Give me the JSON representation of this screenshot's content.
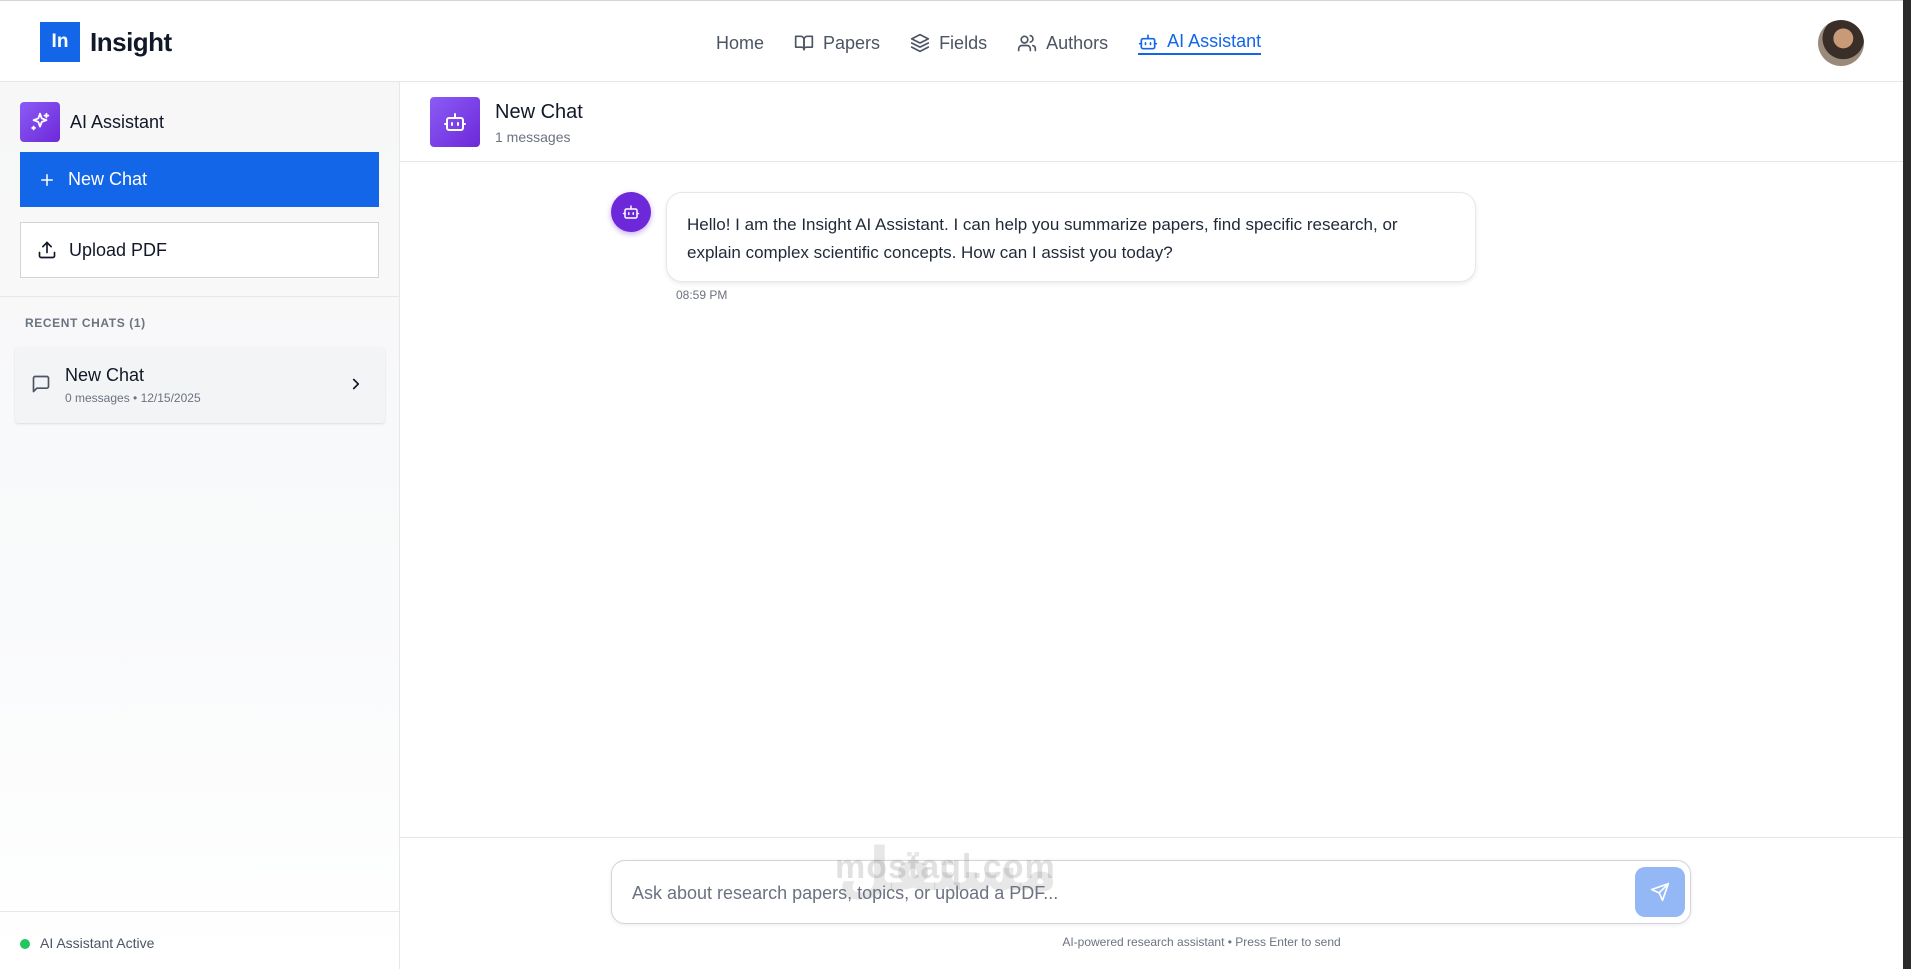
{
  "brand": {
    "mark": "In",
    "name": "Insight"
  },
  "nav": {
    "items": [
      {
        "label": "Home",
        "icon": "none"
      },
      {
        "label": "Papers",
        "icon": "book-icon"
      },
      {
        "label": "Fields",
        "icon": "layers-icon"
      },
      {
        "label": "Authors",
        "icon": "users-icon"
      },
      {
        "label": "AI Assistant",
        "icon": "bot-icon",
        "active": true
      }
    ]
  },
  "sidebar": {
    "title": "AI Assistant",
    "new_chat_label": "New Chat",
    "upload_label": "Upload PDF",
    "recent_label": "RECENT CHATS (1)",
    "recent_chats": [
      {
        "title": "New Chat",
        "meta": "0 messages • 12/15/2025"
      }
    ],
    "status": "AI Assistant Active"
  },
  "chat": {
    "title": "New Chat",
    "subtitle": "1 messages",
    "messages": [
      {
        "role": "assistant",
        "text": "Hello! I am the Insight AI Assistant. I can help you summarize papers, find specific research, or explain complex scientific concepts. How can I assist you today?",
        "time": "08:59 PM"
      }
    ],
    "input_placeholder": "Ask about research papers, topics, or upload a PDF...",
    "hint": "AI-powered research assistant • Press Enter to send"
  },
  "watermark": {
    "latin": "mostaql.com",
    "arabic": "مستقل"
  },
  "colors": {
    "primary": "#1466e8",
    "accent": "#6d28d9",
    "status_active": "#22c55e"
  }
}
